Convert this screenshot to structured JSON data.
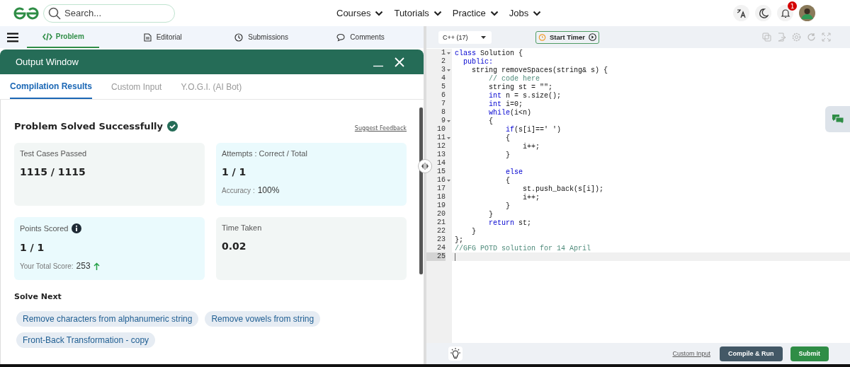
{
  "header": {
    "search": {
      "placeholder": "Search..."
    },
    "nav": [
      {
        "label": "Courses"
      },
      {
        "label": "Tutorials"
      },
      {
        "label": "Practice"
      },
      {
        "label": "Jobs"
      }
    ],
    "notification_count": "1"
  },
  "problem_tabs": [
    {
      "label": "Problem",
      "selected": true
    },
    {
      "label": "Editorial",
      "selected": false
    },
    {
      "label": "Submissions",
      "selected": false
    },
    {
      "label": "Comments",
      "selected": false
    }
  ],
  "output_window": {
    "title": "Output Window",
    "tabs": [
      {
        "label": "Compilation Results",
        "selected": true
      },
      {
        "label": "Custom Input",
        "selected": false
      },
      {
        "label": "Y.O.G.I. (AI Bot)",
        "selected": false
      }
    ],
    "status": "Problem Solved Successfully",
    "feedback_link": "Suggest Feedback",
    "cards": [
      {
        "label": "Test Cases Passed",
        "value": "1115 / 1115",
        "color": "#f2f6f5",
        "info": false
      },
      {
        "label": "Attempts : Correct / Total",
        "value": "1 / 1",
        "color": "#eafafd",
        "info": false,
        "rising": false,
        "note_label": "Accuracy :",
        "note_value": "100%"
      },
      {
        "label": "Points Scored",
        "value": "1 / 1",
        "color": "#eafafd",
        "info": true,
        "rising": true,
        "note_label": "Your Total Score:",
        "note_value": "253"
      },
      {
        "label": "Time Taken",
        "value": "0.02",
        "color": "#f2f6f5",
        "info": false
      }
    ],
    "solve_next": {
      "heading": "Solve Next",
      "problems": [
        "Remove characters from alphanumeric string",
        "Remove vowels from string",
        "Front-Back Transformation - copy"
      ]
    }
  },
  "editor": {
    "language": "C++ (17)",
    "timer": "Start Timer",
    "lines": [
      {
        "number": "1",
        "foldable": true,
        "active": false,
        "tokens": [
          {
            "text": "class",
            "kind": "kw"
          },
          {
            "text": " Solution {",
            "kind": "plain"
          }
        ]
      },
      {
        "number": "2",
        "foldable": false,
        "active": false,
        "tokens": [
          {
            "text": "  public:",
            "kind": "kw"
          }
        ]
      },
      {
        "number": "3",
        "foldable": true,
        "active": false,
        "tokens": [
          {
            "text": "    string removeSpaces(string& s) {",
            "kind": "plain"
          }
        ]
      },
      {
        "number": "4",
        "foldable": false,
        "active": false,
        "tokens": [
          {
            "text": "        // code here",
            "kind": "comment"
          }
        ]
      },
      {
        "number": "5",
        "foldable": false,
        "active": false,
        "tokens": [
          {
            "text": "        string st = \"\";",
            "kind": "plain"
          }
        ]
      },
      {
        "number": "6",
        "foldable": false,
        "active": false,
        "tokens": [
          {
            "text": "        int",
            "kind": "kw"
          },
          {
            "text": " n = s.size();",
            "kind": "plain"
          }
        ]
      },
      {
        "number": "7",
        "foldable": false,
        "active": false,
        "tokens": [
          {
            "text": "        int",
            "kind": "kw"
          },
          {
            "text": " i=0;",
            "kind": "plain"
          }
        ]
      },
      {
        "number": "8",
        "foldable": false,
        "active": false,
        "tokens": [
          {
            "text": "        while",
            "kind": "kw"
          },
          {
            "text": "(i<n)",
            "kind": "plain"
          }
        ]
      },
      {
        "number": "9",
        "foldable": true,
        "active": false,
        "tokens": [
          {
            "text": "        {",
            "kind": "plain"
          }
        ]
      },
      {
        "number": "10",
        "foldable": false,
        "active": false,
        "tokens": [
          {
            "text": "            if",
            "kind": "kw"
          },
          {
            "text": "(s[i]==' ')",
            "kind": "plain"
          }
        ]
      },
      {
        "number": "11",
        "foldable": true,
        "active": false,
        "tokens": [
          {
            "text": "            {",
            "kind": "plain"
          }
        ]
      },
      {
        "number": "12",
        "foldable": false,
        "active": false,
        "tokens": [
          {
            "text": "                i++;",
            "kind": "plain"
          }
        ]
      },
      {
        "number": "13",
        "foldable": false,
        "active": false,
        "tokens": [
          {
            "text": "            }",
            "kind": "plain"
          }
        ]
      },
      {
        "number": "14",
        "foldable": false,
        "active": false
      },
      {
        "number": "15",
        "foldable": false,
        "active": false,
        "tokens": [
          {
            "text": "            else",
            "kind": "kw"
          }
        ]
      },
      {
        "number": "16",
        "foldable": true,
        "active": false,
        "tokens": [
          {
            "text": "            {",
            "kind": "plain"
          }
        ]
      },
      {
        "number": "17",
        "foldable": false,
        "active": false,
        "tokens": [
          {
            "text": "                st.push_back(s[i]);",
            "kind": "plain"
          }
        ]
      },
      {
        "number": "18",
        "foldable": false,
        "active": false,
        "tokens": [
          {
            "text": "                i++;",
            "kind": "plain"
          }
        ]
      },
      {
        "number": "19",
        "foldable": false,
        "active": false,
        "tokens": [
          {
            "text": "            }",
            "kind": "plain"
          }
        ]
      },
      {
        "number": "20",
        "foldable": false,
        "active": false,
        "tokens": [
          {
            "text": "        }",
            "kind": "plain"
          }
        ]
      },
      {
        "number": "21",
        "foldable": false,
        "active": false,
        "tokens": [
          {
            "text": "        return",
            "kind": "kw"
          },
          {
            "text": " st;",
            "kind": "plain"
          }
        ]
      },
      {
        "number": "22",
        "foldable": false,
        "active": false,
        "tokens": [
          {
            "text": "    }",
            "kind": "plain"
          }
        ]
      },
      {
        "number": "23",
        "foldable": false,
        "active": false,
        "tokens": [
          {
            "text": "};",
            "kind": "plain"
          }
        ]
      },
      {
        "number": "24",
        "foldable": false,
        "active": false,
        "tokens": [
          {
            "text": "//GFG POTD solution for 14 April",
            "kind": "comment"
          }
        ]
      },
      {
        "number": "25",
        "foldable": false,
        "active": true
      }
    ],
    "footer": {
      "custom_input": "Custom Input",
      "compile_run": "Compile & Run",
      "submit": "Submit"
    }
  }
}
